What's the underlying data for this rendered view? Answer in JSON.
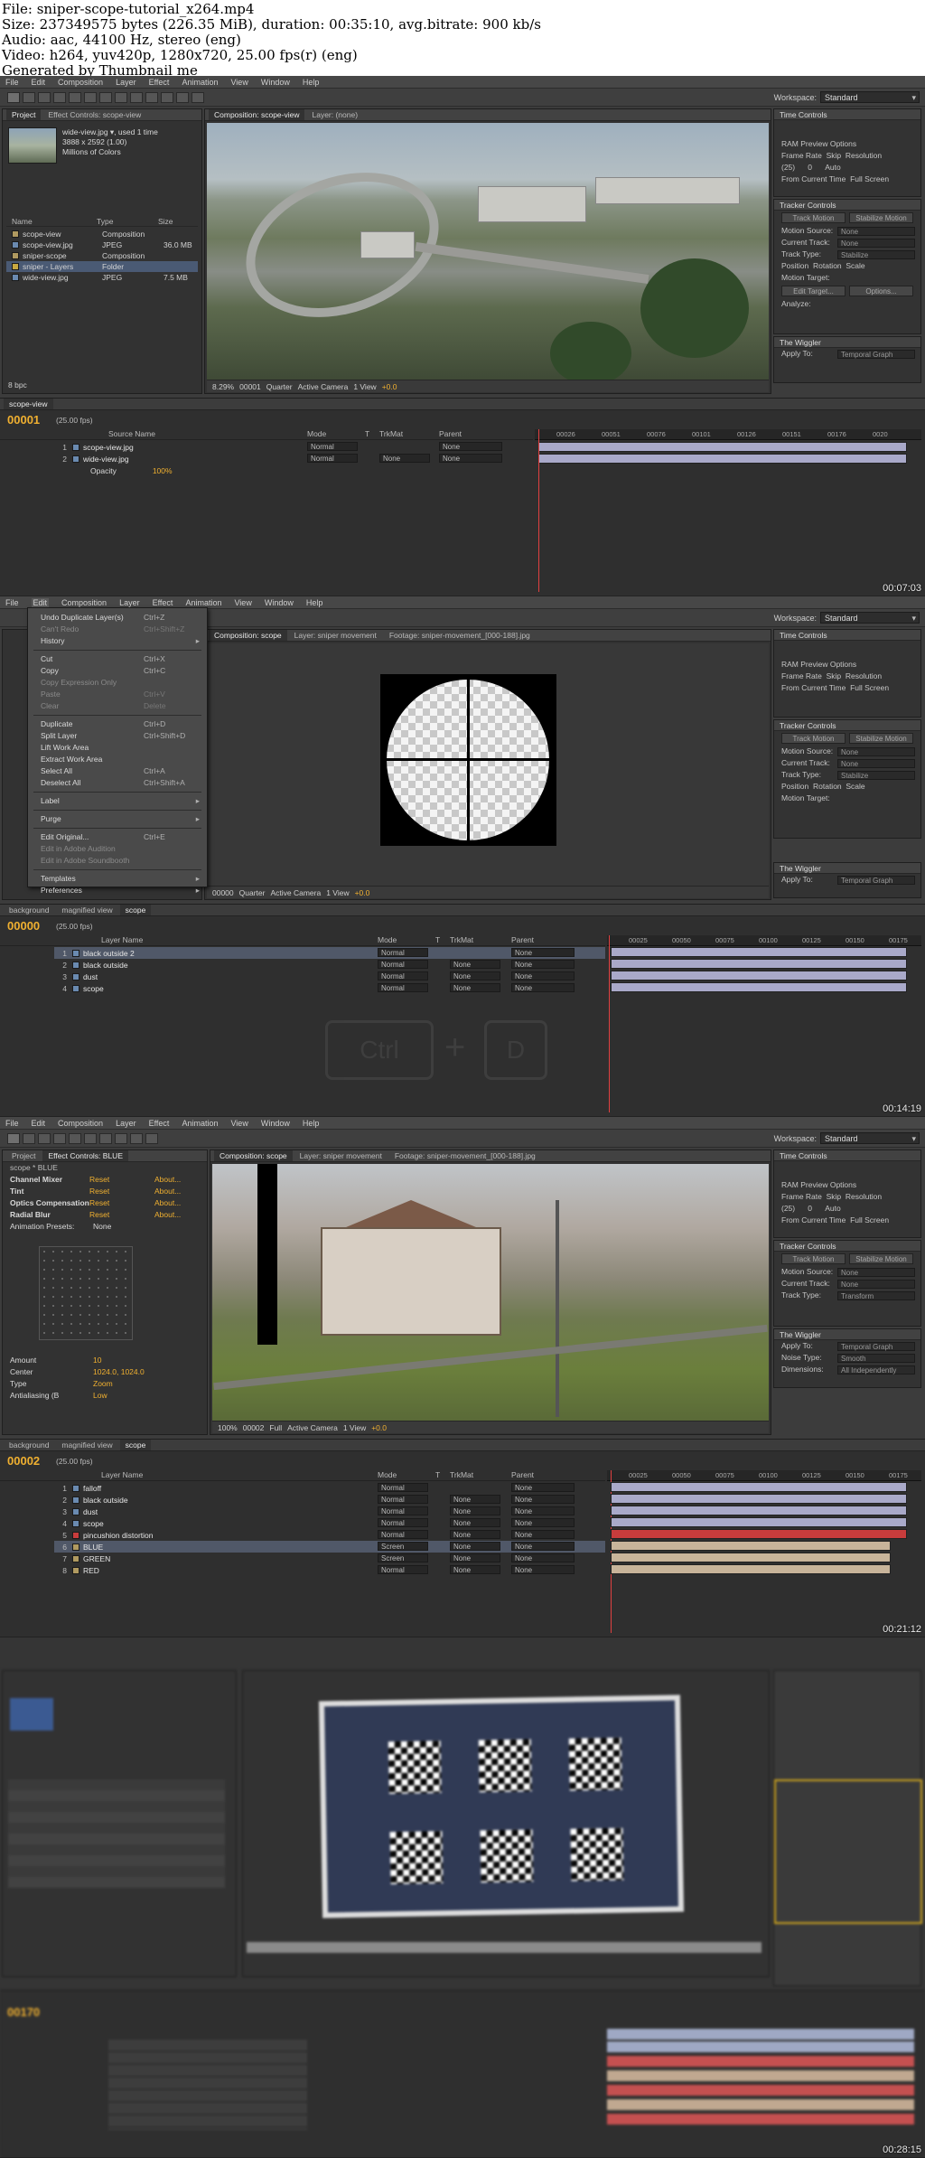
{
  "info": {
    "file": "File: sniper-scope-tutorial_x264.mp4",
    "size": "Size: 237349575 bytes (226.35 MiB), duration: 00:35:10, avg.bitrate: 900 kb/s",
    "audio": "Audio: aac, 44100 Hz, stereo (eng)",
    "video": "Video: h264, yuv420p, 1280x720, 25.00 fps(r) (eng)",
    "generator": "Generated by Thumbnail me"
  },
  "menu": [
    "File",
    "Edit",
    "Composition",
    "Layer",
    "Effect",
    "Animation",
    "View",
    "Window",
    "Help"
  ],
  "workspace": {
    "label": "Workspace:",
    "value": "Standard"
  },
  "shot1": {
    "timestamp": "00:07:03",
    "project_tabs": [
      "Project",
      "Effect Controls: scope-view"
    ],
    "item_name": "wide-view.jpg ▾, used 1 time",
    "item_dims": "3888 x 2592 (1.00)",
    "item_colors": "Millions of Colors",
    "cols": [
      "Name",
      "Type",
      "Size"
    ],
    "items": [
      {
        "name": "scope-view",
        "type": "Composition",
        "size": ""
      },
      {
        "name": "scope-view.jpg",
        "type": "JPEG",
        "size": "36.0 MB"
      },
      {
        "name": "sniper-scope",
        "type": "Composition",
        "size": ""
      },
      {
        "name": "sniper - Layers",
        "type": "Folder",
        "size": ""
      },
      {
        "name": "wide-view.jpg",
        "type": "JPEG",
        "size": "7.5 MB"
      }
    ],
    "bpc": "8 bpc",
    "comp_tabs": [
      "Composition: scope-view",
      "Layer: (none)"
    ],
    "viewer": {
      "zoom": "8.29%",
      "frame": "00001",
      "res": "Quarter",
      "camera": "Active Camera",
      "views": "1 View",
      "exposure": "+0.0"
    },
    "timeline_tab": "scope-view",
    "timecode": "00001",
    "fps": "(25.00 fps)",
    "col_head": [
      "Source Name",
      "Mode",
      "T",
      "TrkMat",
      "Parent"
    ],
    "layers": [
      {
        "num": "1",
        "name": "scope-view.jpg",
        "mode": "Normal",
        "trk": "",
        "parent": "None"
      },
      {
        "num": "2",
        "name": "wide-view.jpg",
        "mode": "Normal",
        "trk": "None",
        "parent": "None"
      }
    ],
    "opacity_label": "Opacity",
    "opacity_value": "100%",
    "ruler": [
      "00026",
      "00051",
      "00076",
      "00101",
      "00126",
      "00151",
      "00176",
      "0020"
    ]
  },
  "shot2": {
    "timestamp": "00:14:19",
    "edit_menu": [
      {
        "label": "Undo Duplicate Layer(s)",
        "key": "Ctrl+Z",
        "dis": false
      },
      {
        "label": "Can't Redo",
        "key": "Ctrl+Shift+Z",
        "dis": true
      },
      {
        "label": "History",
        "key": "",
        "sub": true,
        "dis": false
      },
      {
        "sep": true
      },
      {
        "label": "Cut",
        "key": "Ctrl+X",
        "dis": false
      },
      {
        "label": "Copy",
        "key": "Ctrl+C",
        "dis": false
      },
      {
        "label": "Copy Expression Only",
        "key": "",
        "dis": true
      },
      {
        "label": "Paste",
        "key": "Ctrl+V",
        "dis": true
      },
      {
        "label": "Clear",
        "key": "Delete",
        "dis": true
      },
      {
        "sep": true
      },
      {
        "label": "Duplicate",
        "key": "Ctrl+D",
        "dis": false
      },
      {
        "label": "Split Layer",
        "key": "Ctrl+Shift+D",
        "dis": false
      },
      {
        "label": "Lift Work Area",
        "key": "",
        "dis": false
      },
      {
        "label": "Extract Work Area",
        "key": "",
        "dis": false
      },
      {
        "label": "Select All",
        "key": "Ctrl+A",
        "dis": false
      },
      {
        "label": "Deselect All",
        "key": "Ctrl+Shift+A",
        "dis": false
      },
      {
        "sep": true
      },
      {
        "label": "Label",
        "key": "",
        "sub": true,
        "dis": false
      },
      {
        "sep": true
      },
      {
        "label": "Purge",
        "key": "",
        "sub": true,
        "dis": false
      },
      {
        "sep": true
      },
      {
        "label": "Edit Original...",
        "key": "Ctrl+E",
        "dis": false
      },
      {
        "label": "Edit in Adobe Audition",
        "key": "",
        "dis": true
      },
      {
        "label": "Edit in Adobe Soundbooth",
        "key": "",
        "dis": true
      },
      {
        "sep": true
      },
      {
        "label": "Templates",
        "key": "",
        "sub": true,
        "dis": false
      },
      {
        "label": "Preferences",
        "key": "",
        "sub": true,
        "dis": false
      }
    ],
    "comp_tabs": [
      "Composition: scope",
      "Layer: sniper movement",
      "Footage: sniper-movement_[000-188].jpg"
    ],
    "viewer": {
      "frame": "00000",
      "res": "Quarter",
      "camera": "Active Camera",
      "views": "1 View",
      "exposure": "+0.0"
    },
    "timeline_tabs": [
      "background",
      "magnified view",
      "scope"
    ],
    "timecode": "00000",
    "fps": "(25.00 fps)",
    "col_head": [
      "Layer Name",
      "Mode",
      "T",
      "TrkMat",
      "Parent"
    ],
    "layers": [
      {
        "num": "1",
        "name": "black outside 2",
        "mode": "Normal",
        "trk": "",
        "parent": "None"
      },
      {
        "num": "2",
        "name": "black outside",
        "mode": "Normal",
        "trk": "None",
        "parent": "None"
      },
      {
        "num": "3",
        "name": "dust",
        "mode": "Normal",
        "trk": "None",
        "parent": "None"
      },
      {
        "num": "4",
        "name": "scope",
        "mode": "Normal",
        "trk": "None",
        "parent": "None"
      }
    ],
    "key_hint": {
      "k1": "Ctrl",
      "plus": "+",
      "k2": "D"
    },
    "ruler": [
      "00025",
      "00050",
      "00075",
      "00100",
      "00125",
      "00150",
      "00175"
    ]
  },
  "shot3": {
    "timestamp": "00:21:12",
    "project_tabs": [
      "Project",
      "Effect Controls: BLUE"
    ],
    "fx_header": "scope * BLUE",
    "effects": [
      {
        "name": "Channel Mixer",
        "reset": "Reset",
        "about": "About..."
      },
      {
        "name": "Tint",
        "reset": "Reset",
        "about": "About..."
      },
      {
        "name": "Optics Compensation",
        "reset": "Reset",
        "about": "About..."
      },
      {
        "name": "Radial Blur",
        "reset": "Reset",
        "about": "About..."
      }
    ],
    "presets_label": "Animation Presets:",
    "presets_value": "None",
    "params": [
      {
        "label": "Amount",
        "value": "10"
      },
      {
        "label": "Center",
        "value": "1024.0, 1024.0"
      },
      {
        "label": "Type",
        "value": "Zoom"
      },
      {
        "label": "Antialiasing (B",
        "value": "Low"
      }
    ],
    "comp_tabs": [
      "Composition: scope",
      "Layer: sniper movement",
      "Footage: sniper-movement_[000-188].jpg"
    ],
    "viewer": {
      "zoom": "100%",
      "frame": "00002",
      "res": "Full",
      "camera": "Active Camera",
      "views": "1 View",
      "exposure": "+0.0"
    },
    "timeline_tabs": [
      "background",
      "magnified view",
      "scope"
    ],
    "timecode": "00002",
    "fps": "(25.00 fps)",
    "col_head": [
      "Layer Name",
      "Mode",
      "T",
      "TrkMat",
      "Parent"
    ],
    "layers": [
      {
        "num": "1",
        "name": "falloff",
        "mode": "Normal",
        "trk": "",
        "parent": "None"
      },
      {
        "num": "2",
        "name": "black outside",
        "mode": "Normal",
        "trk": "None",
        "parent": "None"
      },
      {
        "num": "3",
        "name": "dust",
        "mode": "Normal",
        "trk": "None",
        "parent": "None"
      },
      {
        "num": "4",
        "name": "scope",
        "mode": "Normal",
        "trk": "None",
        "parent": "None"
      },
      {
        "num": "5",
        "name": "pincushion distortion",
        "mode": "Normal",
        "trk": "None",
        "parent": "None"
      },
      {
        "num": "6",
        "name": "BLUE",
        "mode": "Screen",
        "trk": "None",
        "parent": "None"
      },
      {
        "num": "7",
        "name": "GREEN",
        "mode": "Screen",
        "trk": "None",
        "parent": "None"
      },
      {
        "num": "8",
        "name": "RED",
        "mode": "Normal",
        "trk": "None",
        "parent": "None"
      }
    ],
    "right_panels": {
      "time_controls": "Time Controls",
      "ram": "RAM Preview Options",
      "frame_rate": "Frame Rate",
      "skip": "Skip",
      "resolution": "Resolution",
      "fr_val": "(25)",
      "skip_val": "0",
      "res_val": "Auto",
      "from_current": "From Current Time",
      "full_screen": "Full Screen",
      "tracker": "Tracker Controls",
      "track_motion": "Track Motion",
      "stabilize_motion": "Stabilize Motion",
      "motion_source": "Motion Source:",
      "ms_val": "None",
      "current_track": "Current Track:",
      "ct_val": "None",
      "track_type": "Track Type:",
      "tt_val": "Transform",
      "wiggler": "The Wiggler",
      "apply_to": "Apply To:",
      "apply_val": "Temporal Graph",
      "noise_type": "Noise Type:",
      "noise_val": "Smooth",
      "dimensions": "Dimensions:",
      "dim_val": "All Independently"
    },
    "ruler": [
      "00025",
      "00050",
      "00075",
      "00100",
      "00125",
      "00150",
      "00175"
    ]
  },
  "shot4": {
    "timestamp": "00:28:15",
    "timecode": "00170"
  },
  "right_common": {
    "time_controls": "Time Controls",
    "ram": "RAM Preview Options",
    "frame_rate": "Frame Rate",
    "skip": "Skip",
    "resolution": "Resolution",
    "fr_val": "(25)",
    "skip_val": "0",
    "res_val": "Auto",
    "from_current": "From Current Time",
    "full_screen": "Full Screen",
    "tracker": "Tracker Controls",
    "track_motion": "Track Motion",
    "stabilize_motion": "Stabilize Motion",
    "motion_source": "Motion Source:",
    "ms_val": "None",
    "current_track": "Current Track:",
    "ct_val": "None",
    "track_type": "Track Type:",
    "tt_val": "Stabilize",
    "pos": "Position",
    "rot": "Rotation",
    "scale": "Scale",
    "motion_target": "Motion Target:",
    "edit_target": "Edit Target...",
    "options": "Options...",
    "analyze": "Analyze:",
    "wiggler": "The Wiggler",
    "apply_to": "Apply To:",
    "apply_val": "Temporal Graph"
  }
}
